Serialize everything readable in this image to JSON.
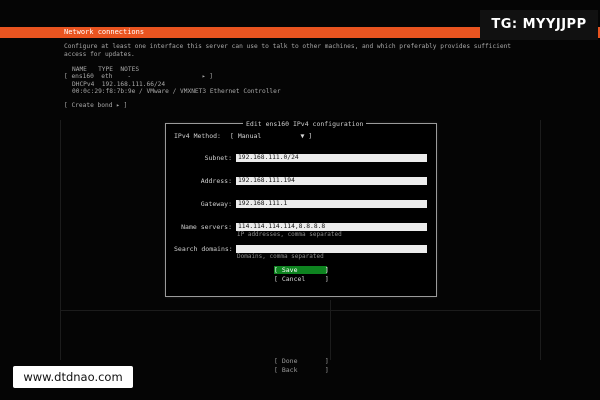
{
  "header": {
    "title": "Network connections",
    "bar_color": "#e95420"
  },
  "overlay_label": "TG: MYYJJPP",
  "description": "Configure at least one interface this server can use to talk to other machines, and which preferably provides sufficient\naccess for updates.",
  "interfaces_table": {
    "header": "NAME   TYPE  NOTES",
    "rows": [
      {
        "line": "[ ens160  eth    -                   ▸ ]",
        "details": [
          "DHCPv4  192.168.111.66/24",
          "00:0c:29:f8:7b:9e / VMware / VMXNET3 Ethernet Controller"
        ]
      }
    ]
  },
  "create_bond": "[ Create bond ▸ ]",
  "dialog": {
    "title": "Edit ens160 IPv4 configuration",
    "method_label": "IPv4 Method:",
    "method_value": "[ Manual          ▼ ]",
    "subnet_label": "Subnet:",
    "subnet_value": "192.168.111.0/24",
    "address_label": "Address:",
    "address_value": "192.168.111.194",
    "gateway_label": "Gateway:",
    "gateway_value": "192.168.111.1",
    "nameservers_label": "Name servers:",
    "nameservers_value": "114.114.114.114,8.8.8.8",
    "nameservers_hint": "IP addresses, comma separated",
    "searchdomains_label": "Search domains:",
    "searchdomains_value": "",
    "searchdomains_hint": "Domains, comma separated",
    "save_label": "[ Save       ]",
    "cancel_label": "[ Cancel     ]",
    "save_color": "#0e8420"
  },
  "footer": {
    "done_label": "[ Done       ]",
    "back_label": "[ Back       ]"
  },
  "watermark": "www.dtdnao.com"
}
